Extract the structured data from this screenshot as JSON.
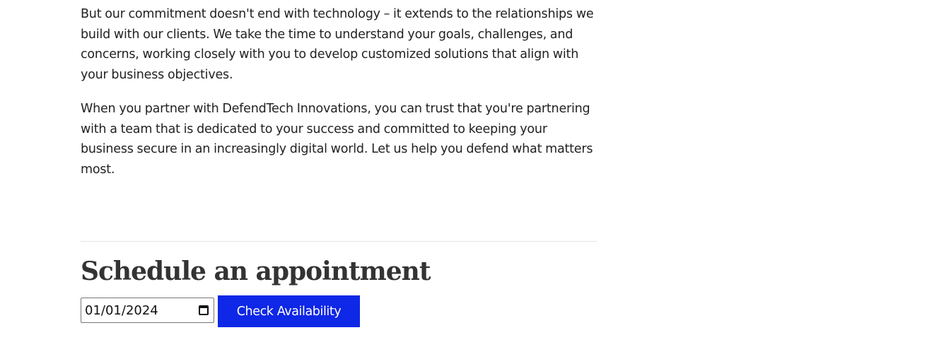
{
  "content": {
    "paragraph_1": "But our commitment doesn't end with technology – it extends to the relationships we build with our clients. We take the time to understand your goals, challenges, and concerns, working closely with you to develop customized solutions that align with your business objectives.",
    "paragraph_2": "When you partner with DefendTech Innovations, you can trust that you're partnering with a team that is dedicated to your success and committed to keeping your business secure in an increasingly digital world. Let us help you defend what matters most."
  },
  "appointment": {
    "heading": "Schedule an appointment",
    "date_value": "01/01/2024",
    "button_label": "Check Availability"
  },
  "colors": {
    "button_bg": "#0f27e6",
    "button_text": "#ffffff",
    "text": "#222222"
  },
  "icons": {
    "date_picker": "calendar-icon"
  }
}
